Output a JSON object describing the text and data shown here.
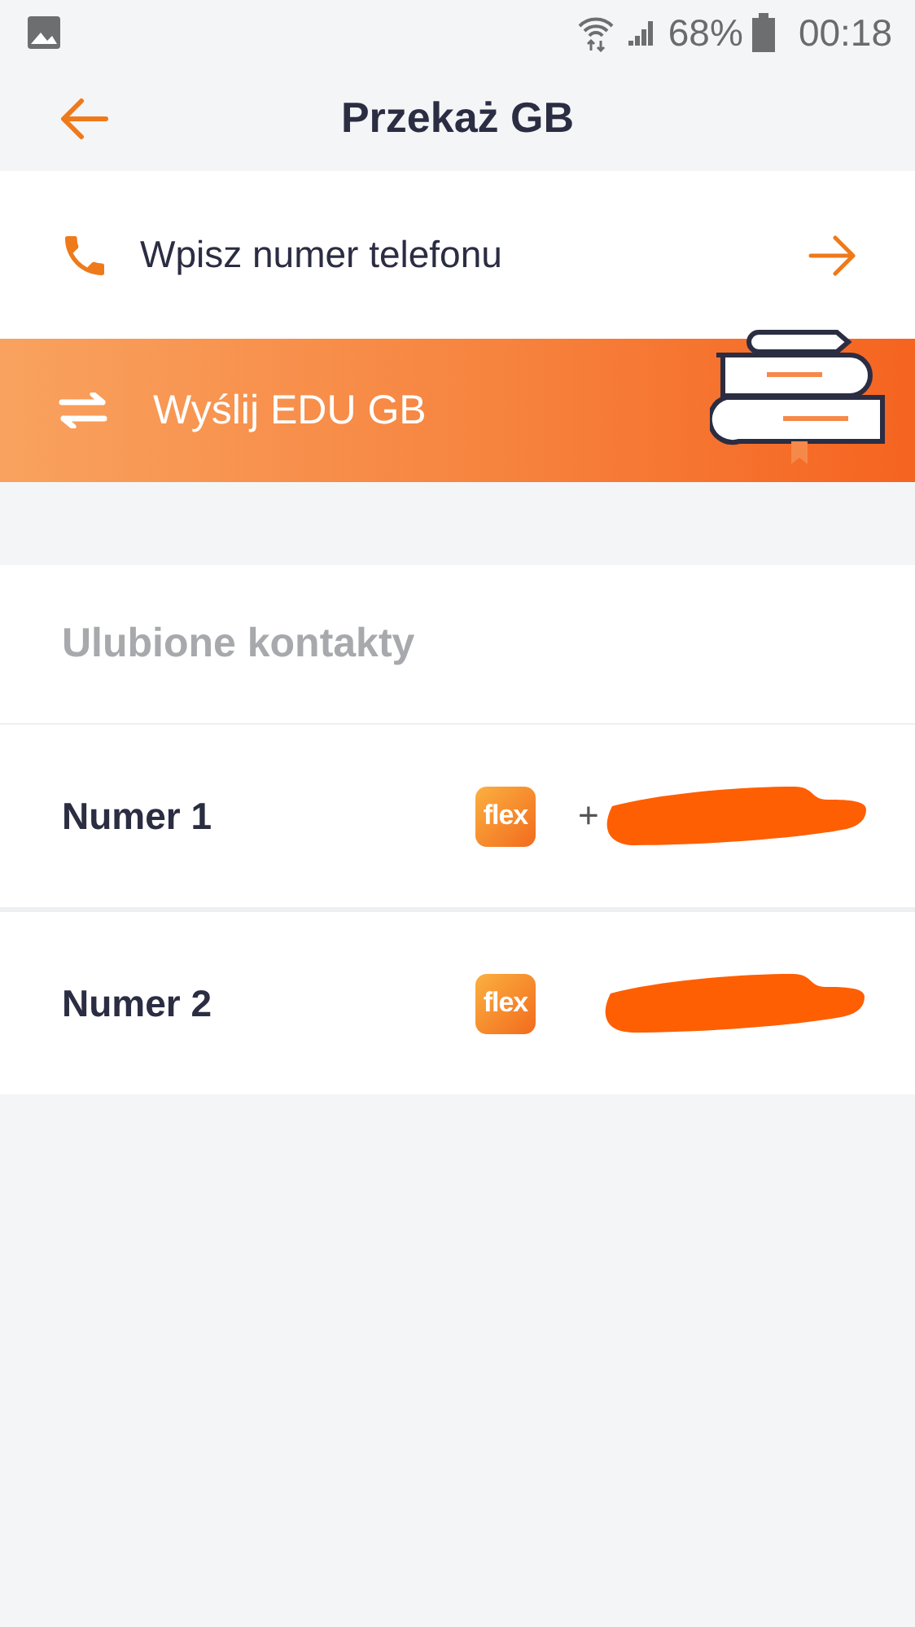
{
  "status_bar": {
    "battery": "68%",
    "time": "00:18"
  },
  "header": {
    "title": "Przekaż GB"
  },
  "phone_entry": {
    "label": "Wpisz numer telefonu"
  },
  "edu_banner": {
    "label": "Wyślij EDU GB"
  },
  "favorites": {
    "title": "Ulubione kontakty",
    "contacts": [
      {
        "name": "Numer 1",
        "badge": "flex",
        "number_prefix": "+"
      },
      {
        "name": "Numer 2",
        "badge": "flex"
      }
    ]
  }
}
